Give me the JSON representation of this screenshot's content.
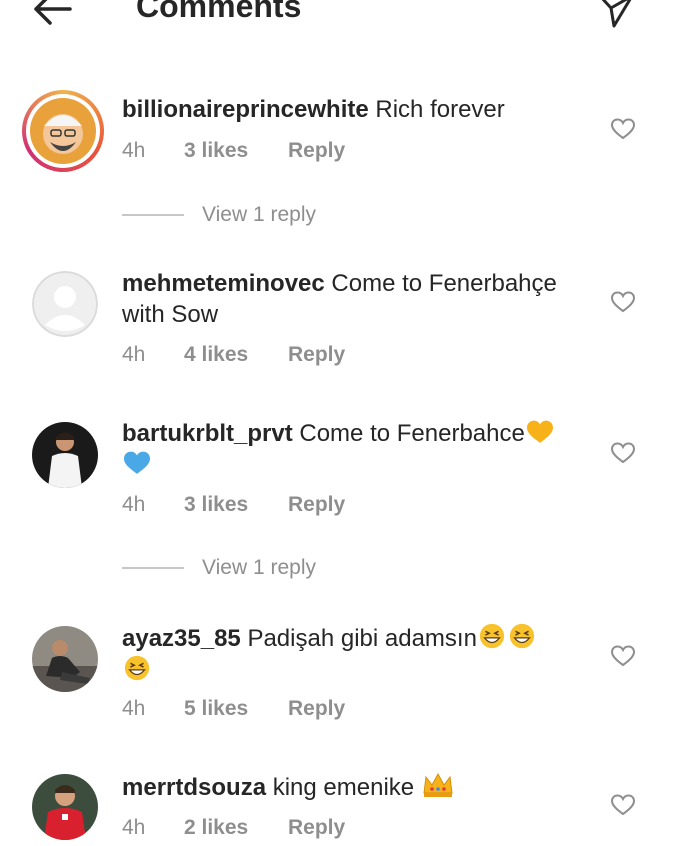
{
  "header": {
    "title": "Comments",
    "back_icon": "arrow-left-icon",
    "share_icon": "send-icon"
  },
  "comments": [
    {
      "username": "billionaireprincewhite",
      "text": "Rich forever",
      "time": "4h",
      "likes": "3 likes",
      "reply_label": "Reply",
      "view_replies": "View 1 reply",
      "avatar": "profile-photo-icon",
      "has_story_ring": true
    },
    {
      "username": "mehmeteminovec",
      "text": "Come to Fenerbahçe with Sow",
      "time": "4h",
      "likes": "4 likes",
      "reply_label": "Reply",
      "avatar": "default-avatar-icon"
    },
    {
      "username": "bartukrblt_prvt",
      "text": "Come to Fenerbahce",
      "emojis": [
        "yellow-heart-emoji",
        "blue-heart-emoji"
      ],
      "time": "4h",
      "likes": "3 likes",
      "reply_label": "Reply",
      "view_replies": "View 1 reply",
      "avatar": "profile-photo-icon"
    },
    {
      "username": "ayaz35_85",
      "text": "Padişah gibi adamsın",
      "emojis": [
        "grinning-squinting-face-emoji",
        "grinning-squinting-face-emoji",
        "grinning-squinting-face-emoji"
      ],
      "time": "4h",
      "likes": "5 likes",
      "reply_label": "Reply",
      "avatar": "profile-photo-icon"
    },
    {
      "username": "merrtdsouza",
      "text": "king emenike",
      "emojis": [
        "crown-emoji"
      ],
      "time": "4h",
      "likes": "2 likes",
      "reply_label": "Reply",
      "avatar": "profile-photo-icon"
    }
  ],
  "colors": {
    "primary_text": "#262626",
    "secondary_text": "#8e8e8e",
    "heart_outline": "#8e8e8e"
  }
}
